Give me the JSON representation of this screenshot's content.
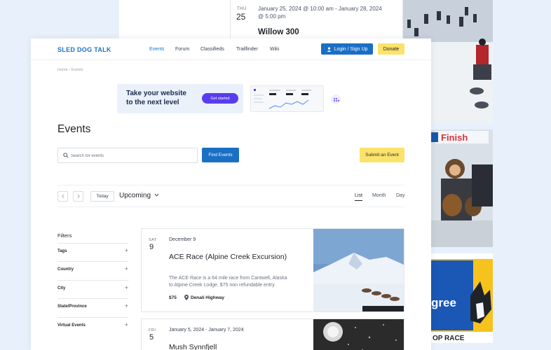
{
  "back_event": {
    "dow": "THU",
    "day": "25",
    "date_line1": "January 25, 2024 @ 10:00 am - January 28, 2024",
    "date_line2": "@ 5:00 pm",
    "title": "Willow 300"
  },
  "nav": {
    "logo": "SLED DOG TALK",
    "links": [
      "Events",
      "Forum",
      "Classifieds",
      "Trailfinder",
      "Wiki"
    ],
    "active_link": "Events",
    "login_label": "Login / Sign Up",
    "donate_label": "Donate"
  },
  "breadcrumb": "Home › Events",
  "ad": {
    "headline_line1": "Take your website",
    "headline_line2": "to the next level",
    "cta": "Get started"
  },
  "page_title": "Events",
  "search": {
    "placeholder": "Search for events",
    "value": "",
    "find_label": "Find Events",
    "submit_label": "Submit an Event"
  },
  "toolbar": {
    "prev_icon": "chevron-left-icon",
    "next_icon": "chevron-right-icon",
    "today_label": "Today",
    "range_label": "Upcoming",
    "views": [
      "List",
      "Month",
      "Day"
    ],
    "active_view": "List"
  },
  "filters": {
    "heading": "Filters",
    "items": [
      "Tags",
      "Country",
      "City",
      "State/Province",
      "Virtual Events"
    ]
  },
  "events": [
    {
      "dow": "SAT",
      "day": "9",
      "date": "December 9",
      "title": "ACE Race (Alpine Creek Excursion)",
      "description": "The ACE Race is a 64 mile race from Cantwell, Alaska to Alpine Creek Lodge. $75 non refundable entry.",
      "price": "$75",
      "venue": "Denali Highway"
    },
    {
      "dow": "FRI",
      "day": "5",
      "date": "January 5, 2024 - January 7, 2024",
      "title": "Mush Synnfjell"
    }
  ],
  "side_photos": {
    "finish_banner": "Finish",
    "sponsor_text_1": "gree",
    "sponsor_text_2": "OP RACE"
  },
  "colors": {
    "brand_blue": "#1a73c8",
    "button_blue": "#1a6fc4",
    "accent_yellow": "#fbe26b",
    "ad_purple": "#5a3cf0",
    "background": "#e8f1fb"
  }
}
